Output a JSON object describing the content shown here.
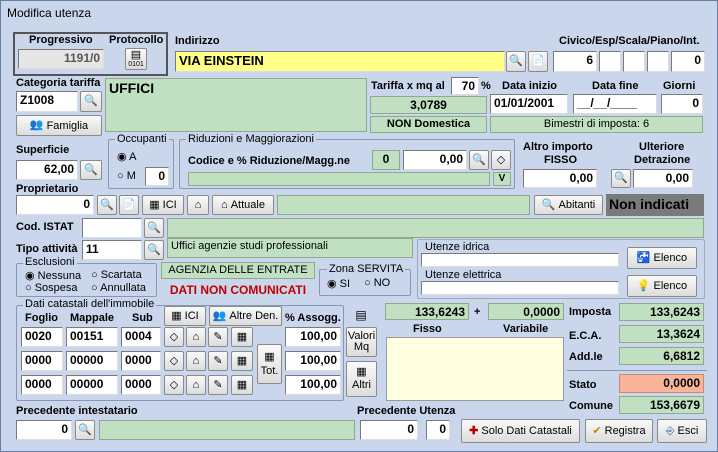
{
  "window": {
    "title": "Modifica utenza"
  },
  "progressivo": {
    "label": "Progressivo",
    "value": "1191/0"
  },
  "protocollo": {
    "label": "Protocollo",
    "icon_text": "0101"
  },
  "indirizzo": {
    "label": "Indirizzo",
    "value": "VIA EINSTEIN",
    "civico_label": "Civico/Esp/Scala/Piano/Int.",
    "civico": "6",
    "esp": "",
    "scala": "",
    "piano": "",
    "interno": "0"
  },
  "categoria": {
    "label": "Categoria tariffa",
    "code": "Z1008",
    "description": "UFFICI",
    "famiglia_button": "Famiglia"
  },
  "tariffa": {
    "label": "Tariffa x mq al",
    "percent": "70",
    "percent_sign": "%",
    "value": "3,0789",
    "tipo": "NON Domestica"
  },
  "date": {
    "inizio_label": "Data inizio",
    "inizio": "01/01/2001",
    "fine_label": "Data fine",
    "fine": "__/__/____",
    "giorni_label": "Giorni",
    "giorni": "0",
    "bimestri": "Bimestri di imposta: 6"
  },
  "superficie": {
    "label": "Superficie",
    "value": "62,00"
  },
  "occupanti": {
    "label": "Occupanti",
    "opt_a": "A",
    "opt_m": "M",
    "m_value": "0"
  },
  "riduzioni": {
    "label": "Riduzioni e Maggiorazioni",
    "codice_label": "Codice e % Riduzione/Magg.ne",
    "codice": "0",
    "percent": "0,00",
    "v_label": "V"
  },
  "altro_importo": {
    "label1": "Altro importo",
    "label2": "FISSO",
    "value": "0,00"
  },
  "ulteriore": {
    "label1": "Ulteriore",
    "label2": "Detrazione",
    "value": "0,00"
  },
  "proprietario": {
    "label": "Proprietario",
    "value": "0",
    "ici_label": "ICI",
    "attuale_label": "Attuale",
    "abitanti_label": "Abitanti",
    "non_indicati": "Non indicati"
  },
  "istat": {
    "label": "Cod. ISTAT",
    "value": ""
  },
  "attivita": {
    "label": "Tipo attività",
    "code": "11",
    "description": "Uffici  agenzie  studi professionali"
  },
  "esclusioni": {
    "label": "Esclusioni",
    "nessuna": "Nessuna",
    "scartata": "Scartata",
    "sospesa": "Sospesa",
    "annullata": "Annullata"
  },
  "agenzia": {
    "label": "AGENZIA DELLE ENTRATE",
    "status": "DATI NON COMUNICATI"
  },
  "zona": {
    "label": "Zona SERVITA",
    "si": "SI",
    "no": "NO"
  },
  "utenze": {
    "idrica_label": "Utenze idrica",
    "elettrica_label": "Utenze elettrica",
    "elenco_label": "Elenco"
  },
  "catastali": {
    "label": "Dati catastali dell'immobile",
    "ici_label": "ICI",
    "altre_den_label": "Altre Den.",
    "assogg_label": "% Assogg.",
    "foglio_label": "Foglio",
    "mappale_label": "Mappale",
    "sub_label": "Sub",
    "tot_label": "Tot.",
    "rows": [
      {
        "foglio": "0020",
        "mappale": "00151",
        "sub": "0004",
        "assogg": "100,00"
      },
      {
        "foglio": "0000",
        "mappale": "00000",
        "sub": "0000",
        "assogg": "100,00"
      },
      {
        "foglio": "0000",
        "mappale": "00000",
        "sub": "0000",
        "assogg": "100,00"
      }
    ]
  },
  "valori": {
    "valori_label1": "Valori",
    "valori_label2": "Mq",
    "altri_label": "Altri"
  },
  "importi": {
    "fisso_value": "133,6243",
    "plus": "+",
    "variabile_value": "0,0000",
    "fisso_label": "Fisso",
    "variabile_label": "Variabile"
  },
  "totali": {
    "imposta_label": "Imposta",
    "imposta": "133,6243",
    "eca_label": "E.C.A.",
    "eca": "13,3624",
    "addle_label": "Add.le",
    "addle": "6,6812",
    "stato_label": "Stato",
    "stato": "0,0000",
    "comune_label": "Comune",
    "comune": "153,6679"
  },
  "precedente": {
    "intestatario_label": "Precedente intestatario",
    "intestatario": "0",
    "utenza_label": "Precedente Utenza",
    "utenza1": "0",
    "utenza2": "0"
  },
  "buttons": {
    "solo_label": "Solo Dati Catastali",
    "registra_label": "Registra",
    "esci_label": "Esci"
  },
  "colors": {
    "window_bg": "#c9d6ec",
    "green_field": "#c1e0c1",
    "yellow_field": "#ffff88",
    "stato_bg": "#f9b59a",
    "cream": "#fefee0"
  }
}
